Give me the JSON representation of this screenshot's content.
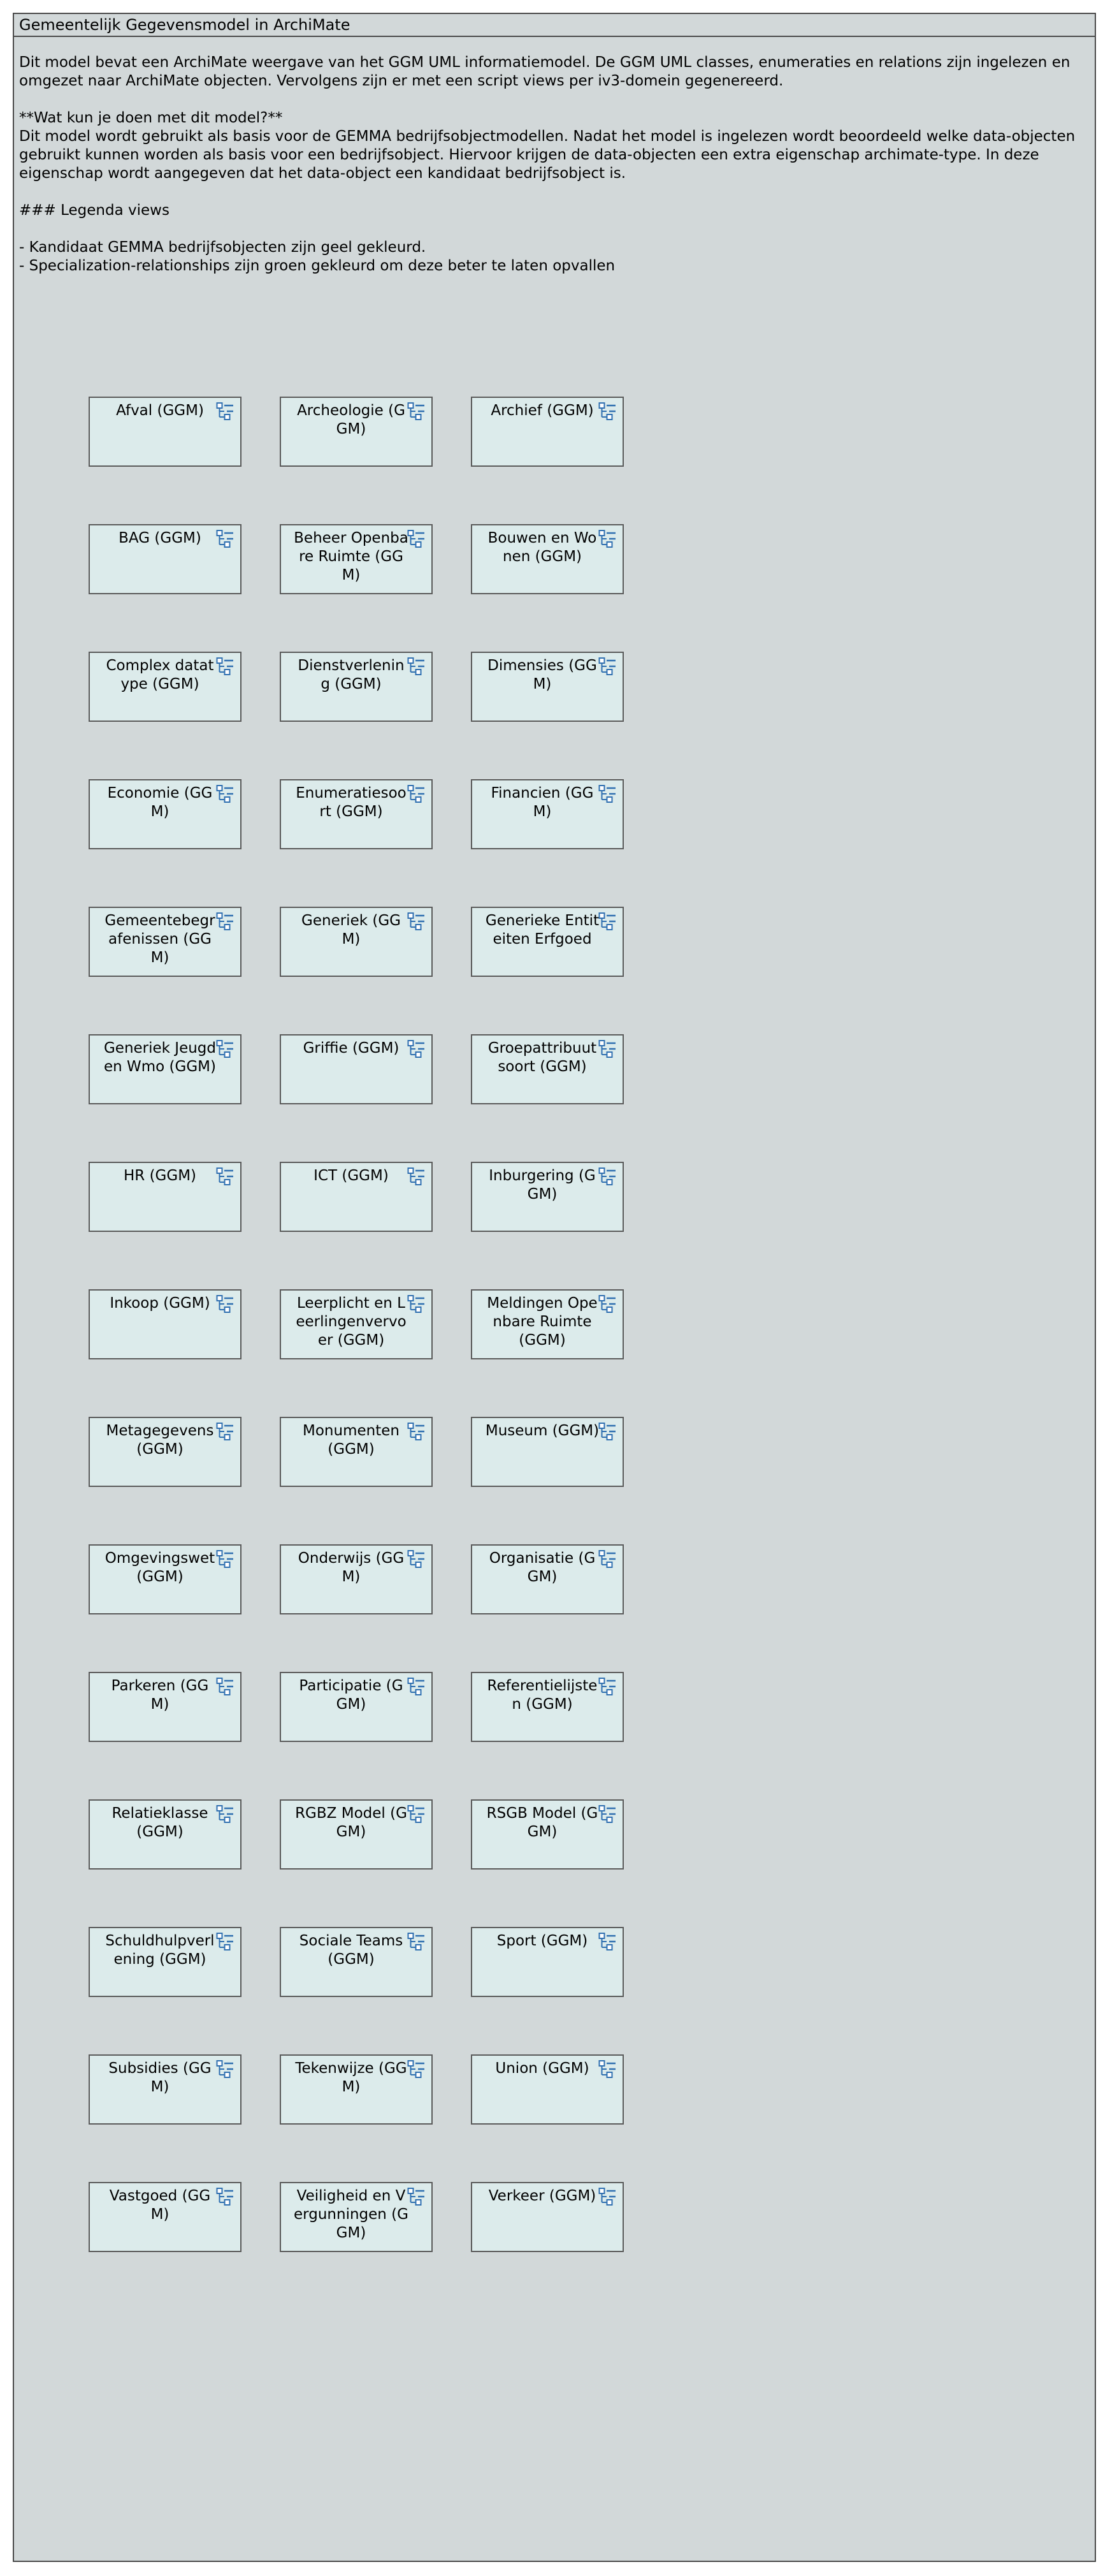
{
  "view": {
    "title": "Gemeentelijk Gegevensmodel in ArchiMate"
  },
  "description": {
    "p1": "Dit model bevat een ArchiMate weergave van het GGM UML informatiemodel. De GGM UML classes, enumeraties en relations zijn ingelezen en omgezet naar ArchiMate objecten. Vervolgens zijn er met een script views per iv3-domein gegenereerd.",
    "p2_heading": "**Wat kun je doen met dit model?**",
    "p2_text": "Dit model wordt gebruikt als basis voor de GEMMA bedrijfsobjectmodellen. Nadat het model is ingelezen wordt beoordeeld welke data-objecten gebruikt kunnen worden als basis voor een bedrijfsobject. Hiervoor krijgen de data-objecten een extra eigenschap archimate-type. In deze eigenschap wordt aangegeven dat het data-object een kandidaat bedrijfsobject is.",
    "p3_heading": "### Legenda views",
    "legend_item_1": "- Kandidaat GEMMA bedrijfsobjecten zijn geel gekleurd.",
    "legend_item_2": "- Specialization-relationships zijn groen gekleurd om deze beter te laten opvallen"
  },
  "icon": "view-reference-icon",
  "nodes": [
    "Afval (GGM)",
    "Archeologie (GGM)",
    "Archief (GGM)",
    "BAG (GGM)",
    "Beheer Openbare Ruimte (GGM)",
    "Bouwen en Wonen (GGM)",
    "Complex datatype (GGM)",
    "Dienstverlening (GGM)",
    "Dimensies (GGM)",
    "Economie (GGM)",
    "Enumeratiesoort (GGM)",
    "Financien (GGM)",
    "Gemeentebegrafenissen (GGM)",
    "Generiek (GGM)",
    "Generieke Entiteiten Erfgoed",
    "Generiek Jeugd en Wmo (GGM)",
    "Griffie (GGM)",
    "Groepattribuutsoort (GGM)",
    "HR (GGM)",
    "ICT (GGM)",
    "Inburgering (GGM)",
    "Inkoop (GGM)",
    "Leerplicht en Leerlingenvervoer (GGM)",
    "Meldingen Openbare Ruimte (GGM)",
    "Metagegevens (GGM)",
    "Monumenten (GGM)",
    "Museum (GGM)",
    "Omgevingswet (GGM)",
    "Onderwijs (GGM)",
    "Organisatie (GGM)",
    "Parkeren (GGM)",
    "Participatie (GGM)",
    "Referentielijsten (GGM)",
    "Relatieklasse (GGM)",
    "RGBZ Model (GGM)",
    "RSGB Model (GGM)",
    "Schuldhulpverlening (GGM)",
    "Sociale Teams (GGM)",
    "Sport (GGM)",
    "Subsidies (GGM)",
    "Tekenwijze (GGM)",
    "Union (GGM)",
    "Vastgoed (GGM)",
    "Veiligheid en Vergunningen (GGM)",
    "Verkeer (GGM)"
  ]
}
